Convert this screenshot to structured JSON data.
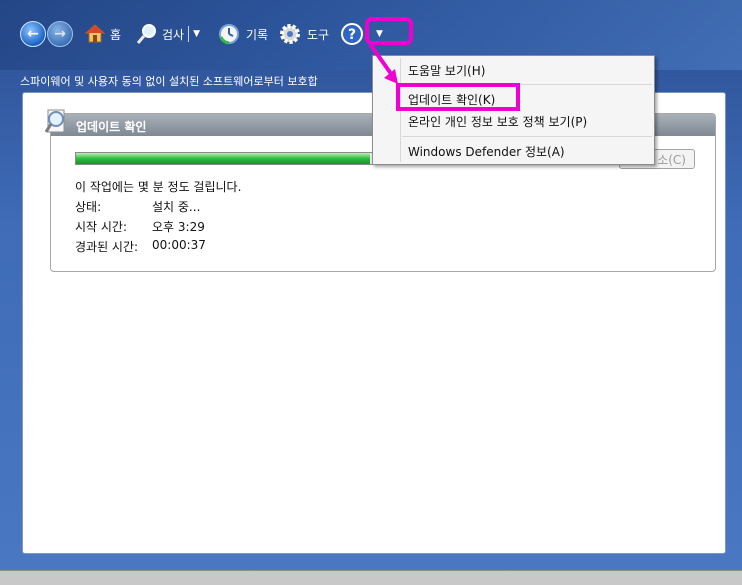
{
  "toolbar": {
    "home_label": "홈",
    "search_label": "검사",
    "history_label": "기록",
    "tools_label": "도구"
  },
  "subtitle": "스파이웨어 및 사용자 동의 없이 설치된 소프트웨어로부터 보호합",
  "panel": {
    "title": "업데이트 확인",
    "progress_fraction": 0.92,
    "cancel_label": "소(C)",
    "message": "이 작업에는 몇 분 정도 걸립니다.",
    "rows": [
      {
        "label": "상태:",
        "value": "설치 중..."
      },
      {
        "label": "시작 시간:",
        "value": "오후 3:29"
      },
      {
        "label": "경과된 시간:",
        "value": "00:00:37"
      }
    ]
  },
  "menu": {
    "items": [
      "도움말 보기(H)",
      "업데이트 확인(K)",
      "온라인 개인 정보 보호 정책 보기(P)",
      "Windows Defender 정보(A)"
    ]
  },
  "colors": {
    "highlight": "#f000d0",
    "progress": "#2fbe3f"
  },
  "icons": {
    "back": "back-arrow-icon",
    "forward": "forward-arrow-icon",
    "home": "home-icon",
    "search": "magnifier-icon",
    "history": "clock-icon",
    "tools": "gear-icon",
    "help": "help-icon"
  }
}
